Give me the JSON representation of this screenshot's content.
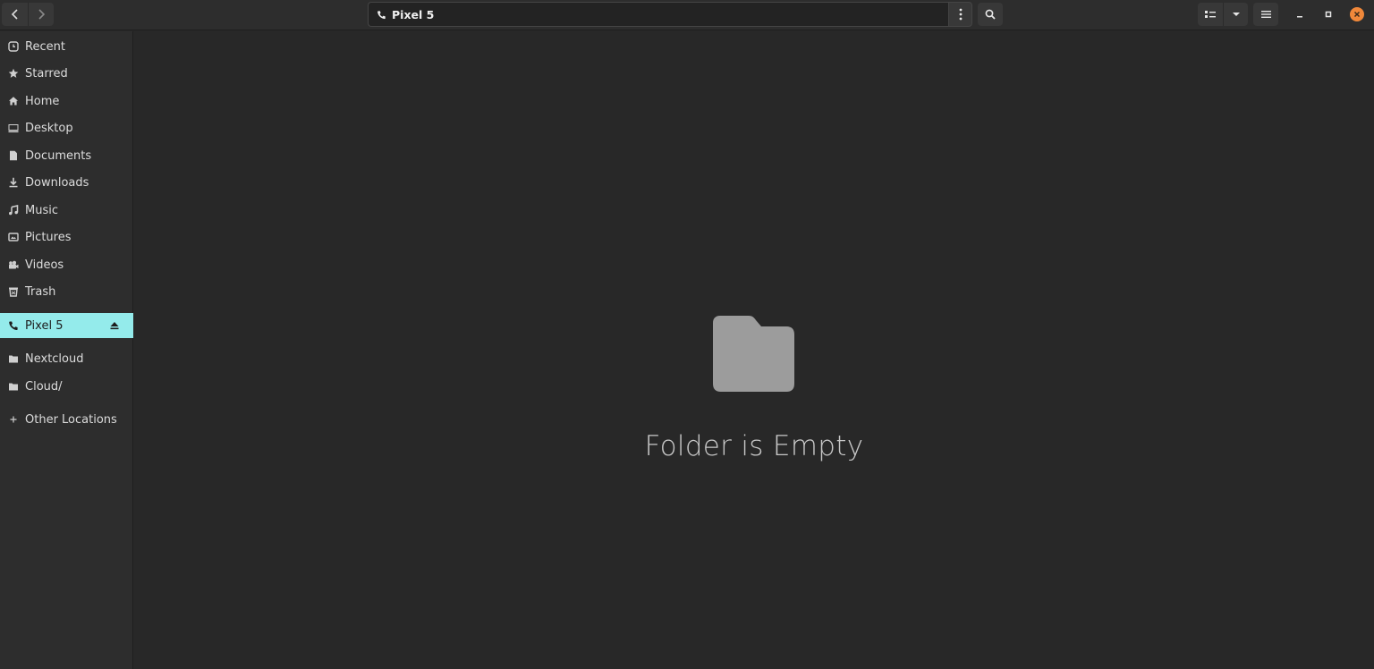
{
  "window": {
    "path": "Pixel 5"
  },
  "header": {
    "icons": {
      "back": "chevron-left-icon",
      "forward": "chevron-right-icon",
      "path_menu": "vertical-dots-icon",
      "search": "search-icon",
      "list_view": "list-view-icon",
      "view_options": "caret-down-icon",
      "main_menu": "hamburger-icon",
      "minimize": "minimize-icon",
      "maximize": "maximize-icon",
      "close": "close-icon"
    }
  },
  "sidebar": {
    "places": [
      {
        "label": "Recent",
        "icon": "clock-icon"
      },
      {
        "label": "Starred",
        "icon": "star-icon"
      },
      {
        "label": "Home",
        "icon": "home-icon"
      },
      {
        "label": "Desktop",
        "icon": "desktop-icon"
      },
      {
        "label": "Documents",
        "icon": "document-icon"
      },
      {
        "label": "Downloads",
        "icon": "download-icon"
      },
      {
        "label": "Music",
        "icon": "music-icon"
      },
      {
        "label": "Pictures",
        "icon": "picture-icon"
      },
      {
        "label": "Videos",
        "icon": "video-icon"
      },
      {
        "label": "Trash",
        "icon": "trash-icon"
      }
    ],
    "devices": [
      {
        "label": "Pixel 5",
        "icon": "phone-icon",
        "selected": true
      }
    ],
    "network": [
      {
        "label": "Nextcloud",
        "icon": "folder-icon"
      },
      {
        "label": "Cloud/",
        "icon": "folder-icon"
      }
    ],
    "other": {
      "label": "Other Locations",
      "icon": "plus-icon"
    }
  },
  "main": {
    "empty_message": "Folder is Empty",
    "empty_icon": "folder-icon"
  },
  "colors": {
    "accent": "#94ebeb",
    "close": "#f0883a",
    "background": "#282828"
  }
}
